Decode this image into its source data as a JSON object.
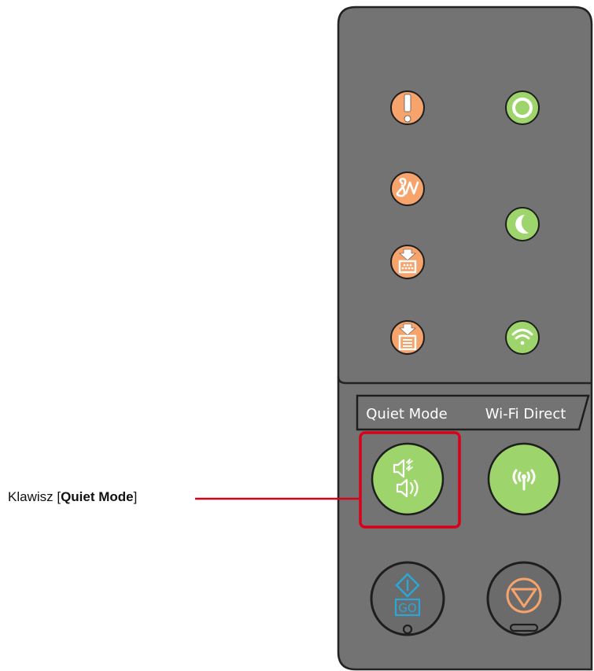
{
  "callout": {
    "prefix": "Klawisz [",
    "key_name": "Quiet Mode",
    "suffix": "]"
  },
  "panel": {
    "key_labels": {
      "quiet_mode": "Quiet Mode",
      "wifi_direct": "Wi-Fi Direct"
    },
    "go_button_text": "GO",
    "indicators": [
      {
        "name": "attention-indicator",
        "icon": "exclamation-icon",
        "color": "#f6a36c"
      },
      {
        "name": "ready-indicator",
        "icon": "ring-icon",
        "color": "#9ed46c"
      },
      {
        "name": "paper-jam-indicator",
        "icon": "jam-icon",
        "color": "#f6a36c"
      },
      {
        "name": "sleep-indicator",
        "icon": "moon-icon",
        "color": "#9ed46c"
      },
      {
        "name": "toner-indicator",
        "icon": "toner-icon",
        "color": "#f6a36c"
      },
      {
        "name": "paper-indicator",
        "icon": "paper-icon",
        "color": "#f6a36c"
      },
      {
        "name": "wifi-indicator",
        "icon": "wifi-icon",
        "color": "#9ed46c"
      }
    ]
  },
  "colors": {
    "panel": "#737373",
    "panel_border": "#232323",
    "highlight": "#d9001b",
    "orange_led": "#f6a36c",
    "green_led": "#9ed46c",
    "go_blue": "#2aa6d8",
    "stop_orange": "#f6a36c"
  }
}
